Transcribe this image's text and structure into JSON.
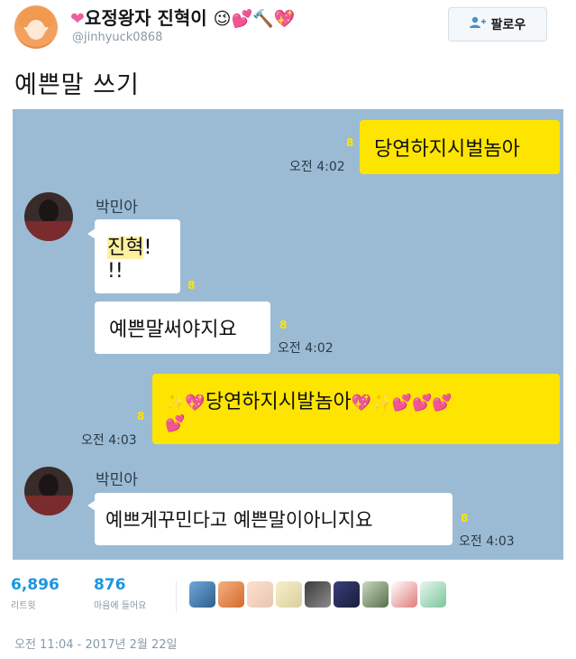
{
  "header": {
    "display_name": "요정왕자 진혁이",
    "emoji_lead": "❤",
    "emoji_tail": "😉💕🔨💖",
    "handle": "@jinhyuck0868",
    "follow_label": "팔로우",
    "follow_icon": "person-plus-icon"
  },
  "tweet": {
    "text": "예쁜말 쓰기"
  },
  "chat": {
    "messages": [
      {
        "side": "me",
        "text": "당연하지시벌놈아",
        "read": "8",
        "time": "오전 4:02"
      },
      {
        "side": "other",
        "sender": "박민아",
        "text_hl": "진혁",
        "text_rest": "!",
        "text_line2": "!!",
        "read": "8"
      },
      {
        "side": "other",
        "text": "예쁜말써야지요",
        "read": "8",
        "time": "오전 4:02"
      },
      {
        "side": "me",
        "deco_lead": "✨💖",
        "text": "당연하지시발놈아",
        "deco_tail": "💖✨💕💕💕",
        "deco_line2": "💕",
        "read": "8",
        "time": "오전 4:03"
      },
      {
        "side": "other",
        "sender": "박민아",
        "text": "예쁘게꾸민다고 예쁜말이아니지요",
        "read": "8",
        "time": "오전 4:03"
      }
    ],
    "colors": {
      "background": "#9bbbd4",
      "my_bubble": "#fee500",
      "their_bubble": "#ffffff"
    }
  },
  "stats": {
    "retweets": {
      "count": "6,896",
      "label": "리트윗"
    },
    "likes": {
      "count": "876",
      "label": "마음에 들어요"
    }
  },
  "timestamp": "오전 11:04 - 2017년 2월 22일"
}
